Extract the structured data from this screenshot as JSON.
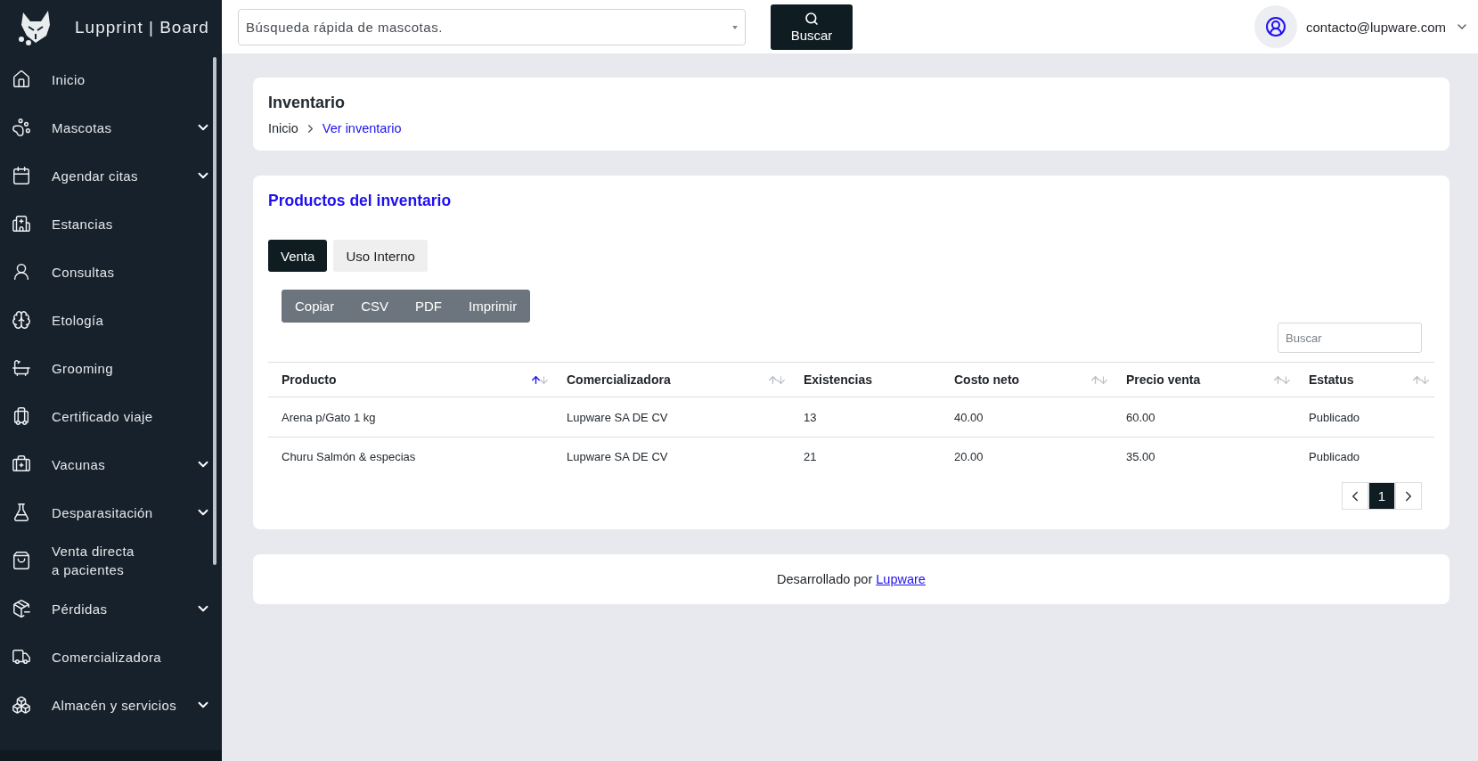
{
  "brand": {
    "name": "Lupprint | Board"
  },
  "sidebar": {
    "items": [
      {
        "label": "Inicio"
      },
      {
        "label": "Mascotas",
        "expanded": false
      },
      {
        "label": "Agendar citas",
        "expanded": false
      },
      {
        "label": "Estancias"
      },
      {
        "label": "Consultas"
      },
      {
        "label": "Etología"
      },
      {
        "label": "Grooming"
      },
      {
        "label": "Certificado viaje"
      },
      {
        "label": "Vacunas",
        "expanded": false
      },
      {
        "label": "Desparasitación",
        "expanded": false
      },
      {
        "label": "Venta directa\na pacientes"
      },
      {
        "label": "Pérdidas",
        "expanded": false
      },
      {
        "label": "Comercializadora"
      },
      {
        "label": "Almacén y servicios",
        "expanded": false
      }
    ]
  },
  "topbar": {
    "search": {
      "placeholder": "Búsqueda rápida de mascotas."
    },
    "search_button": "Buscar",
    "user": "contacto@lupware.com"
  },
  "page_header": {
    "title": "Inventario",
    "breadcrumb": [
      {
        "label": "Inicio",
        "current": false
      },
      {
        "label": "Ver inventario",
        "current": true
      }
    ]
  },
  "products": {
    "title": "Productos del inventario",
    "tabs": [
      {
        "label": "Venta",
        "selected": true
      },
      {
        "label": "Uso Interno",
        "selected": false
      }
    ],
    "export_buttons": [
      "Copiar",
      "CSV",
      "PDF",
      "Imprimir"
    ],
    "search": {
      "placeholder": "Buscar"
    },
    "table": {
      "columns": [
        {
          "label": "Producto",
          "sorted": true
        },
        {
          "label": "Comercializadora",
          "sorted": false
        },
        {
          "label": "Existencias"
        },
        {
          "label": "Costo neto",
          "sorted": false
        },
        {
          "label": "Precio venta",
          "sorted": false
        },
        {
          "label": "Estatus",
          "sorted": false
        }
      ],
      "rows": [
        [
          "Arena p/Gato 1 kg",
          "Lupware SA DE CV",
          "13",
          "40.00",
          "60.00",
          "Publicado"
        ],
        [
          "Churu Salmón & especias",
          "Lupware SA DE CV",
          "21",
          "20.00",
          "35.00",
          "Publicado"
        ]
      ]
    },
    "pagination": {
      "pages": [
        {
          "label": "1",
          "selected": true
        }
      ]
    }
  },
  "footer": {
    "text": "Desarrollado por",
    "link": "Lupware"
  }
}
